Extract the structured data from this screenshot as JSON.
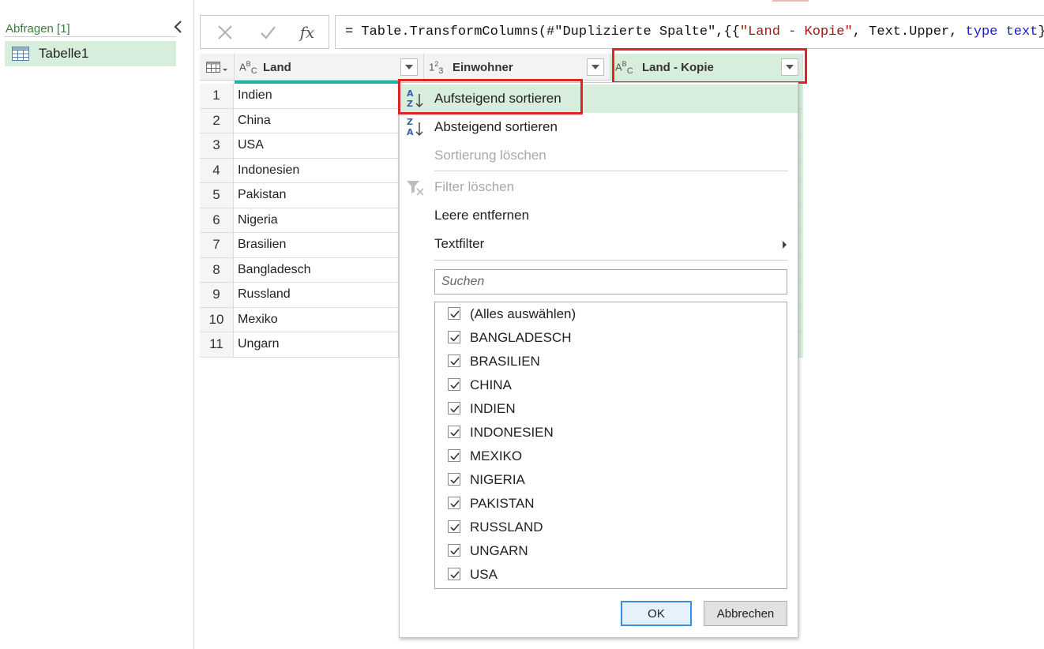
{
  "left_pane": {
    "queries_label": "Abfragen [1]",
    "query_item": "Tabelle1"
  },
  "formula_bar": {
    "cancel_icon": "close-icon",
    "confirm_icon": "check-icon",
    "fx_label": "fx",
    "formula_prefix": "= Table.TransformColumns(#\"Duplizierte Spalte\",{{",
    "formula_string": "\"Land - Kopie\"",
    "formula_mid": ", Text.Upper, ",
    "formula_kw_type": "type",
    "formula_space": " ",
    "formula_kw_text": "text",
    "formula_suffix": "}})"
  },
  "table": {
    "columns": [
      {
        "type_icon": "ABC",
        "label": "Land"
      },
      {
        "type_icon": "123",
        "label": "Einwohner"
      },
      {
        "type_icon": "ABC",
        "label": "Land - Kopie"
      }
    ],
    "rows": [
      {
        "num": "1",
        "land": "Indien"
      },
      {
        "num": "2",
        "land": "China"
      },
      {
        "num": "3",
        "land": "USA"
      },
      {
        "num": "4",
        "land": "Indonesien"
      },
      {
        "num": "5",
        "land": "Pakistan"
      },
      {
        "num": "6",
        "land": "Nigeria"
      },
      {
        "num": "7",
        "land": "Brasilien"
      },
      {
        "num": "8",
        "land": "Bangladesch"
      },
      {
        "num": "9",
        "land": "Russland"
      },
      {
        "num": "10",
        "land": "Mexiko"
      },
      {
        "num": "11",
        "land": "Ungarn"
      }
    ]
  },
  "menu": {
    "sort_asc": "Aufsteigend sortieren",
    "sort_desc": "Absteigend sortieren",
    "clear_sort": "Sortierung löschen",
    "clear_filter": "Filter löschen",
    "remove_empty": "Leere entfernen",
    "text_filter": "Textfilter",
    "search_placeholder": "Suchen",
    "checklist": [
      {
        "label": "(Alles auswählen)",
        "checked": true
      },
      {
        "label": "BANGLADESCH",
        "checked": true
      },
      {
        "label": "BRASILIEN",
        "checked": true
      },
      {
        "label": "CHINA",
        "checked": true
      },
      {
        "label": "INDIEN",
        "checked": true
      },
      {
        "label": "INDONESIEN",
        "checked": true
      },
      {
        "label": "MEXIKO",
        "checked": true
      },
      {
        "label": "NIGERIA",
        "checked": true
      },
      {
        "label": "PAKISTAN",
        "checked": true
      },
      {
        "label": "RUSSLAND",
        "checked": true
      },
      {
        "label": "UNGARN",
        "checked": true
      },
      {
        "label": "USA",
        "checked": true
      }
    ],
    "ok_label": "OK",
    "cancel_label": "Abbrechen"
  },
  "colors": {
    "accent_green": "#d7eedc",
    "highlight_red": "#e02424",
    "column_accent": "#1ab5a8"
  }
}
